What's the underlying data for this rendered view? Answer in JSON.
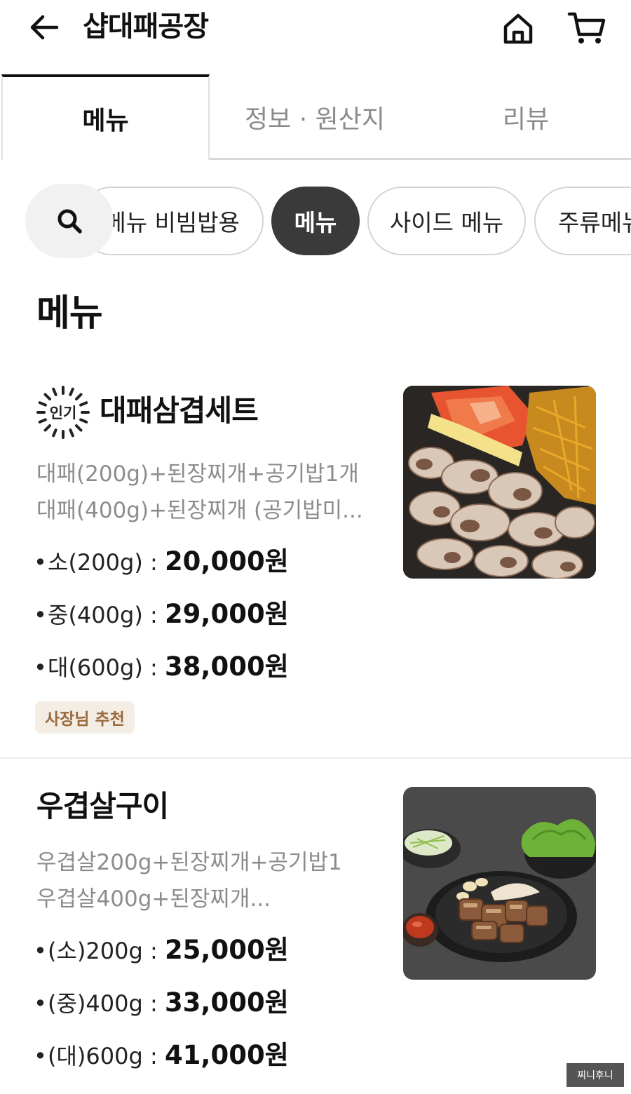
{
  "header": {
    "title": "샵대패공장",
    "back_icon": "arrow-left-icon",
    "home_icon": "home-icon",
    "cart_icon": "cart-icon"
  },
  "tabs": [
    {
      "label": "메뉴",
      "active": true
    },
    {
      "label": "정보 · 원산지",
      "active": false
    },
    {
      "label": "리뷰",
      "active": false
    }
  ],
  "chips": {
    "search_icon": "search-icon",
    "items": [
      {
        "label": "메뉴 비빔밥용",
        "selected": false
      },
      {
        "label": "메뉴",
        "selected": true
      },
      {
        "label": "사이드 메뉴",
        "selected": false
      },
      {
        "label": "주류메뉴",
        "selected": false
      }
    ]
  },
  "section_title": "메뉴",
  "menu_items": [
    {
      "badge": "인기",
      "name": "대패삼겹세트",
      "description": [
        "대패(200g)+된장찌개+공기밥1개",
        "대패(400g)+된장찌개 (공기밥미..."
      ],
      "prices": [
        {
          "option": "소(200g) : ",
          "amount": "20,000원"
        },
        {
          "option": "중(400g) : ",
          "amount": "29,000원"
        },
        {
          "option": "대(600g) : ",
          "amount": "38,000원"
        }
      ],
      "tag": "사장님 추천"
    },
    {
      "name": "우겹살구이",
      "description": [
        "우겹살200g+된장찌개+공기밥1",
        "우겹살400g+된장찌개..."
      ],
      "prices": [
        {
          "option": "(소)200g : ",
          "amount": "25,000원"
        },
        {
          "option": "(중)400g : ",
          "amount": "33,000원"
        },
        {
          "option": "(대)600g : ",
          "amount": "41,000원"
        }
      ]
    }
  ],
  "watermark": "찌니후니",
  "colors": {
    "selected_chip_bg": "#3a3a3a",
    "tag_bg": "#f3ede4",
    "tag_text": "#9a6a3e",
    "muted_text": "#8c8c8c"
  }
}
